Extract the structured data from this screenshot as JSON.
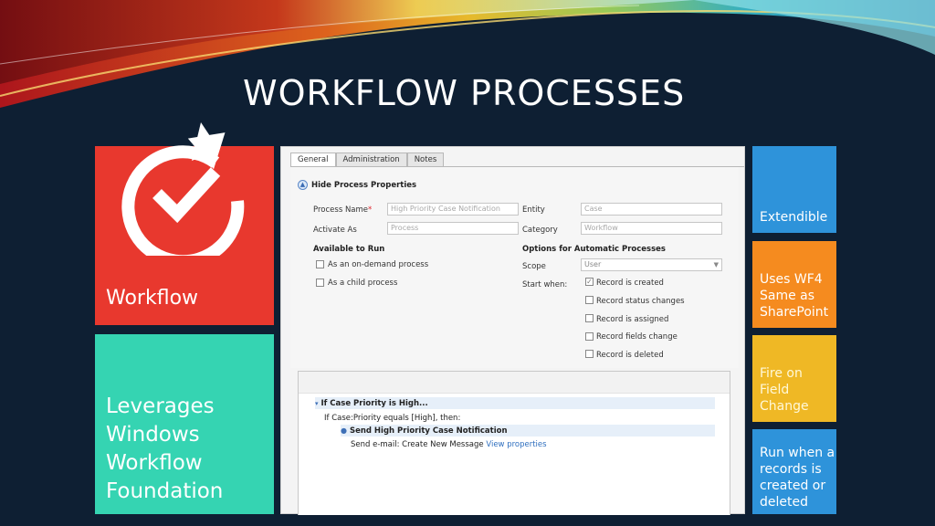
{
  "slide": {
    "title": "WORKFLOW PROCESSES"
  },
  "tiles": {
    "workflow": "Workflow",
    "leverages": "Leverages\nWindows\nWorkflow\nFoundation"
  },
  "side_tiles": [
    {
      "label": "Extendible"
    },
    {
      "label": "Uses WF4\nSame as\nSharePoint"
    },
    {
      "label": "Fire on\nField\nChange"
    },
    {
      "label": "Run when a\nrecords is\ncreated or\ndeleted"
    }
  ],
  "form": {
    "tabs": [
      "General",
      "Administration",
      "Notes"
    ],
    "hide_props": "Hide Process Properties",
    "process_name_label": "Process Name",
    "required_mark": "*",
    "process_name_value": "High Priority Case Notification",
    "activate_as_label": "Activate As",
    "activate_as_value": "Process",
    "entity_label": "Entity",
    "entity_value": "Case",
    "category_label": "Category",
    "category_value": "Workflow",
    "available_to_run": "Available to Run",
    "on_demand": "As an on-demand process",
    "child_process": "As a child process",
    "options_auto": "Options for Automatic Processes",
    "scope_label": "Scope",
    "scope_value": "User",
    "start_when_label": "Start when:",
    "start_options": [
      "Record is created",
      "Record status changes",
      "Record is assigned",
      "Record fields change",
      "Record is deleted"
    ]
  },
  "steps": {
    "condition": "If Case Priority is High...",
    "condition_detail": "If Case:Priority equals [High], then:",
    "action": "Send High Priority Case Notification",
    "action_detail": "Send e-mail:  Create New Message",
    "view_link": "View properties"
  },
  "colors": {
    "background": "#0e1f33",
    "workflow_tile": "#e8382e",
    "leverages_tile": "#35d4b2",
    "blue_tile": "#2e93da",
    "orange_tile": "#f58b1f",
    "yellow_tile": "#efb825"
  },
  "icons": {
    "workflow_logo": "circular-arrow-checkmark-icon"
  }
}
